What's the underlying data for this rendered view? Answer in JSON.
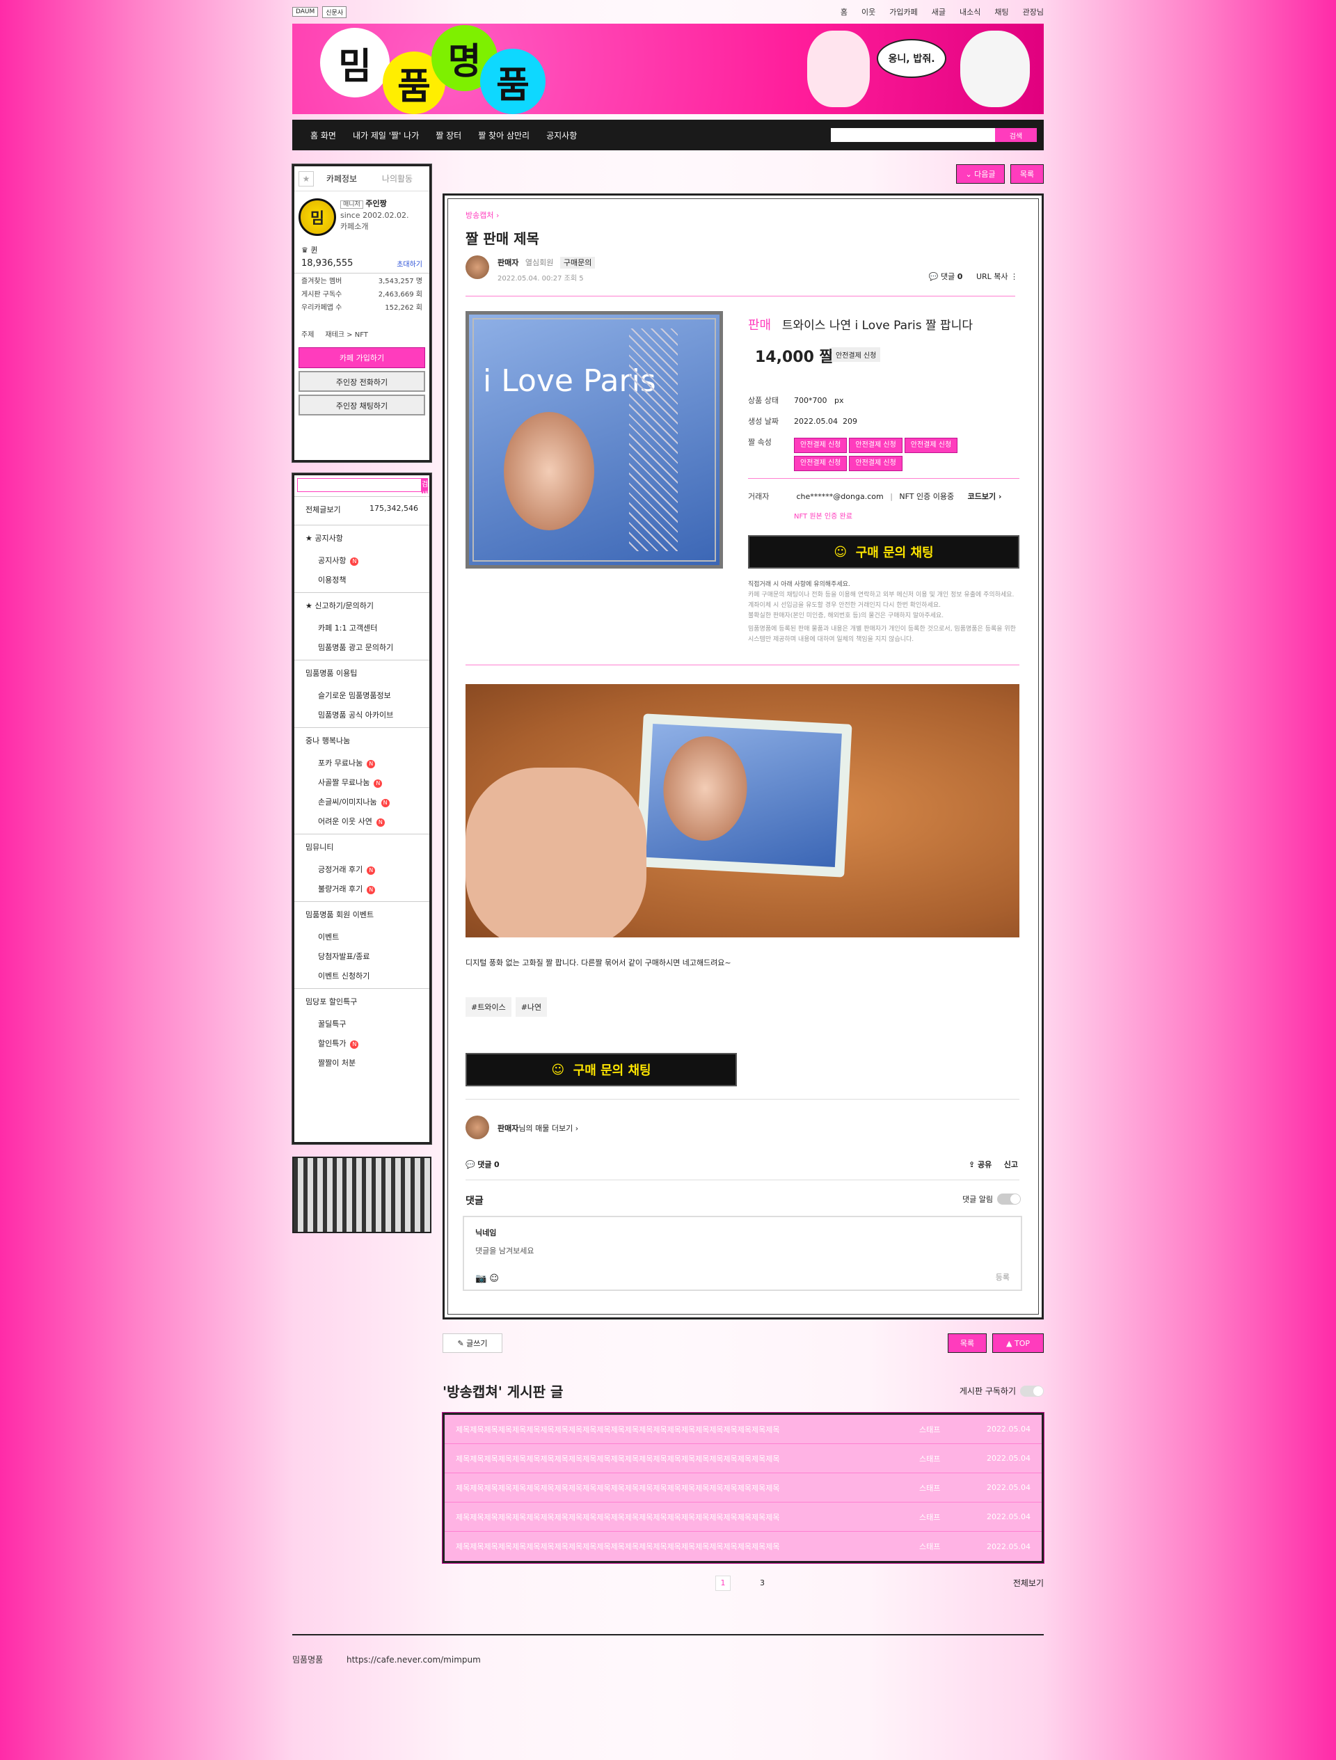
{
  "gnb": {
    "logos": [
      "DAUM",
      "신문사"
    ],
    "menu": [
      "홈",
      "이웃",
      "가입카페",
      "새글",
      "내소식",
      "채팅",
      "관장님"
    ]
  },
  "banner": {
    "chars": [
      "밈",
      "품",
      "명",
      "품"
    ],
    "bubble": "옹니, 밥줘."
  },
  "topnav": {
    "items": [
      "홈 화면",
      "내가 제일 '짤' 나가",
      "짤 장터",
      "짤 찾아 삼만리",
      "공지사항"
    ],
    "search_btn": "검색"
  },
  "side": {
    "tabs": [
      "카페정보",
      "나의활동"
    ],
    "prof": {
      "badge": "매니저",
      "name": "주인짱",
      "since": "since 2002.02.02.",
      "intro": "카페소개",
      "mark": "밈"
    },
    "rank": "퀸",
    "members": "18,936,555",
    "invite": "초대하기",
    "stats": [
      [
        "즐겨찾는 멤버",
        "3,543,257 명"
      ],
      [
        "게시판 구독수",
        "2,463,669 회"
      ],
      [
        "우리카페앱 수",
        "152,262 회"
      ]
    ],
    "topic_label": "주제",
    "topic": "재테크 > NFT",
    "join": "카페 가입하기",
    "call": "주인장 전화하기",
    "chat": "주인장 채팅하기",
    "search_btn": "검색",
    "all_label": "전체글보기",
    "all_count": "175,342,546",
    "menus": [
      {
        "sec": "★ 공지사항",
        "items": [
          "공지사항",
          "이용정책"
        ]
      },
      {
        "sec": "★ 신고하기/문의하기",
        "items": [
          "카페 1:1 고객센터",
          "밈품명품 광고 문의하기"
        ]
      },
      {
        "sec": "밈품명품 이용팁",
        "items": [
          "슬기로운 밈품명품정보",
          "밈품명품 공식 아카이브"
        ]
      },
      {
        "sec": "중나 행복나눔",
        "items": [
          "포카 무료나눔",
          "사골짤 무료나눔",
          "손글씨/이미지나눔",
          "어려운 이웃 사연"
        ]
      },
      {
        "sec": "밈뮤니티",
        "items": [
          "긍정거래 후기",
          "불량거래 후기"
        ]
      },
      {
        "sec": "밈품명품 회원 이벤트",
        "items": [
          "이벤트",
          "당첨자발표/종료",
          "이벤트 신청하기"
        ]
      },
      {
        "sec": "밈당포 할인특구",
        "items": [
          "꿀딜특구",
          "할인특가",
          "짤짤이 처분"
        ]
      }
    ]
  },
  "main": {
    "next": "다음글",
    "list": "목록",
    "board": "방송캡처",
    "title": "짤 판매 제목",
    "author": "판매자",
    "grade": "열심회원",
    "ask": "구매문의",
    "date": "2022.05.04. 00:27",
    "views": "조회 5",
    "comments_label": "댓글",
    "comments": "0",
    "url": "URL 복사",
    "photo_text": "i Love Paris",
    "sale": "판매",
    "item": "트와이스 나연 i Love Paris 짤 팝니다",
    "price": "14,000 짤",
    "safe": "안전결제 신청",
    "specs": [
      [
        "상품 상태",
        "700*700",
        "px"
      ],
      [
        "생성 날짜",
        "2022.05.04",
        "209"
      ]
    ],
    "attr_label": "짤 속성",
    "attrs": [
      "안전결제 신청",
      "안전결제 신청",
      "안전결제 신청",
      "안전결제 신청",
      "안전결제 신청"
    ],
    "trader_label": "거래자",
    "trader": "che******@donga.com",
    "nft": "NFT 인증 이용중",
    "code": "코드보기",
    "verified": "NFT 원본 인증 완료",
    "chat": "구매 문의 채팅",
    "notice": [
      "직접거래 시 아래 사항에 유의해주세요.",
      "카페 구매문의 채팅이나 전화 등을 이용해 연락하고 외부 메신저 이용 및 개인 정보 유출에 주의하세요. 계좌이체 시 선입금을 유도할 경우 안전한 거래인지 다시 한번 확인하세요.",
      "불확실한 판매자(본인 미인증, 해외번호 등)의 물건은 구매하지 말아주세요.",
      "밈품명품에 등록된 판매 물품과 내용은 개별 판매자가 개인이 등록한 것으로서, 밈품명품은 등록을 위한 시스템만 제공하며 내용에 대하여 일체의 책임을 지지 않습니다."
    ],
    "body": "디지털 풍화 없는 고화질 짤 팝니다. 다른짤 묶어서 같이 구매하시면 네고해드려요~",
    "tags": [
      "#트와이스",
      "#나연"
    ],
    "more": "님의 매물 더보기",
    "share": "공유",
    "report": "신고",
    "cm_title": "댓글",
    "cm_alarm": "댓글 알림",
    "nick": "닉네임",
    "cm_ph": "댓글을 남겨보세요",
    "reg": "등록",
    "write": "글쓰기",
    "top": "TOP",
    "board_list_title": "'방송캡쳐' 게시판 글",
    "subscribe": "게시판 구독하기",
    "rows": [
      {
        "t": "제목제목제목제목제목제목제목제목제목제목제목제목제목제목제목제목제목제목제목제목제목제목제목",
        "a": "스태프",
        "d": "2022.05.04"
      },
      {
        "t": "제목제목제목제목제목제목제목제목제목제목제목제목제목제목제목제목제목제목제목제목제목제목제목",
        "a": "스태프",
        "d": "2022.05.04"
      },
      {
        "t": "제목제목제목제목제목제목제목제목제목제목제목제목제목제목제목제목제목제목제목제목제목제목제목",
        "a": "스태프",
        "d": "2022.05.04"
      },
      {
        "t": "제목제목제목제목제목제목제목제목제목제목제목제목제목제목제목제목제목제목제목제목제목제목제목",
        "a": "스태프",
        "d": "2022.05.04"
      },
      {
        "t": "제목제목제목제목제목제목제목제목제목제목제목제목제목제목제목제목제목제목제목제목제목제목제목",
        "a": "스태프",
        "d": "2022.05.04"
      }
    ],
    "pages": [
      "1",
      "3"
    ],
    "all": "전체보기"
  },
  "footer": {
    "name": "밈품명품",
    "url": "https://cafe.never.com/mimpum"
  }
}
